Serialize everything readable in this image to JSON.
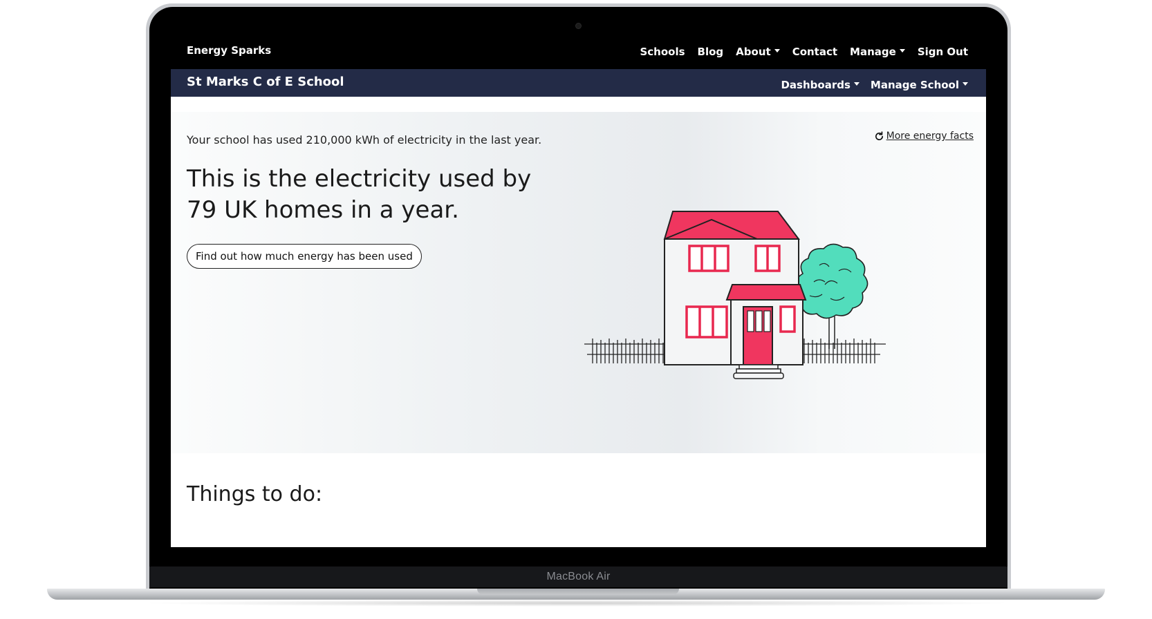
{
  "device": {
    "label": "MacBook Air"
  },
  "topnav": {
    "brand": "Energy Sparks",
    "links": [
      "Schools",
      "Blog",
      "About",
      "Contact",
      "Manage",
      "Sign Out"
    ]
  },
  "subnav": {
    "school_name": "St Marks C of E School",
    "links": [
      "Dashboards",
      "Manage School"
    ]
  },
  "hero": {
    "fact_line": "Your school has used 210,000 kWh of electricity in the last year.",
    "more_facts": "More energy facts",
    "headline_line1": "This is the electricity used by",
    "headline_line2": "79 UK homes in a year.",
    "cta": "Find out how much energy has been used"
  },
  "things_heading": "Things to do:",
  "colors": {
    "topnav_bg": "#000000",
    "subnav_bg": "#232b47",
    "roof_red": "#f0365f",
    "tree_green": "#52ddbc"
  }
}
